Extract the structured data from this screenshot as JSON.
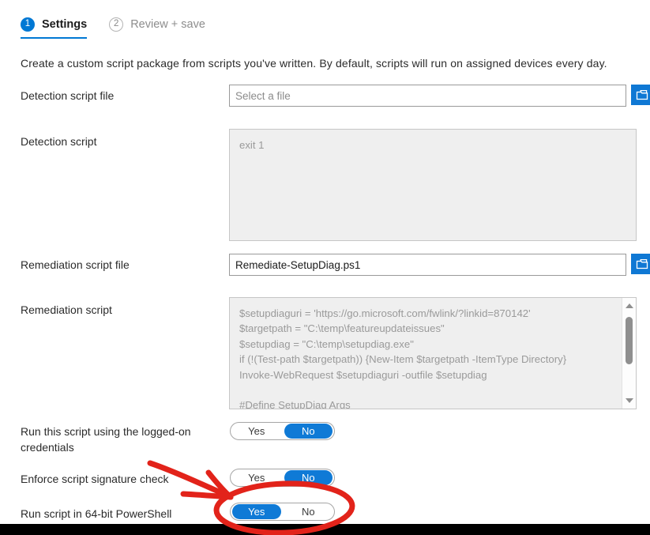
{
  "wizard": {
    "steps": [
      {
        "number": "1",
        "label": "Settings",
        "state": "active"
      },
      {
        "number": "2",
        "label": "Review + save",
        "state": "inactive"
      }
    ]
  },
  "description": "Create a custom script package from scripts you've written. By default, scripts will run on assigned devices every day.",
  "fields": {
    "detection_script_file": {
      "label": "Detection script file",
      "value": "",
      "placeholder": "Select a file",
      "browse_icon": "folder-open-icon"
    },
    "detection_script": {
      "label": "Detection script",
      "value": "exit 1"
    },
    "remediation_script_file": {
      "label": "Remediation script file",
      "value": "Remediate-SetupDiag.ps1",
      "placeholder": "Select a file",
      "browse_icon": "folder-open-icon"
    },
    "remediation_script": {
      "label": "Remediation script",
      "value": "$setupdiaguri = 'https://go.microsoft.com/fwlink/?linkid=870142'\n$targetpath = \"C:\\temp\\featureupdateissues\"\n$setupdiag = \"C:\\temp\\setupdiag.exe\"\nif (!(Test-path $targetpath)) {New-Item $targetpath -ItemType Directory}\nInvoke-WebRequest $setupdiaguri -outfile $setupdiag\n\n#Define SetupDiag Args",
      "scroll_up_icon": "triangle-up-icon",
      "scroll_down_icon": "triangle-down-icon"
    }
  },
  "toggles": [
    {
      "label": "Run this script using the logged-on credentials",
      "yes_label": "Yes",
      "no_label": "No",
      "selected": "No"
    },
    {
      "label": "Enforce script signature check",
      "yes_label": "Yes",
      "no_label": "No",
      "selected": "No"
    },
    {
      "label": "Run script in 64-bit PowerShell",
      "yes_label": "Yes",
      "no_label": "No",
      "selected": "Yes"
    }
  ],
  "annotations": {
    "arrow": "red-arrow-annotation",
    "ellipse": "red-ellipse-annotation",
    "color": "#e2231a"
  },
  "colors": {
    "accent": "#0078d4",
    "toggle_on": "#0f7ad6",
    "annotation_red": "#e2231a",
    "script_box_bg": "#efefef",
    "placeholder_text": "#8b8b8b"
  }
}
